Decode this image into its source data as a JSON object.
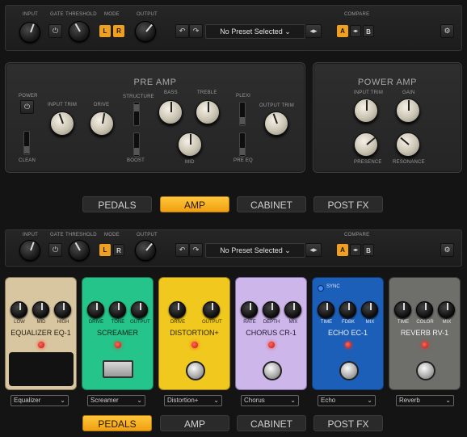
{
  "top_bar": {
    "labels": {
      "input": "INPUT",
      "gate": "GATE",
      "threshold": "THRESHOLD",
      "mode": "MODE",
      "output": "OUTPUT",
      "compare": "COMPARE"
    },
    "mode_l": "L",
    "mode_r": "R",
    "preset": "No Preset Selected",
    "compare_a": "A",
    "compare_arrows": "◂▸",
    "compare_b": "B"
  },
  "pre_amp": {
    "title": "PRE AMP",
    "power": "POWER",
    "input_trim": "INPUT TRIM",
    "drive": "DRIVE",
    "structure": "STRUCTURE",
    "bass": "BASS",
    "treble": "TREBLE",
    "plexi": "PLEXI",
    "output_trim": "OUTPUT TRIM",
    "clean": "CLEAN",
    "boost": "BOOST",
    "mid": "MID",
    "pre_eq": "PRE EQ"
  },
  "power_amp": {
    "title": "POWER AMP",
    "input_trim": "INPUT TRIM",
    "gain": "GAIN",
    "presence": "PRESENCE",
    "resonance": "RESONANCE"
  },
  "tabs_top": [
    {
      "label": "PEDALS",
      "active": false
    },
    {
      "label": "AMP",
      "active": true
    },
    {
      "label": "CABINET",
      "active": false
    },
    {
      "label": "POST FX",
      "active": false
    }
  ],
  "second_bar": {
    "labels": {
      "input": "INPUT",
      "gate": "GATE",
      "threshold": "THRESHOLD",
      "mode": "MODE",
      "output": "OUTPUT",
      "compare": "COMPARE"
    },
    "mode_l": "L",
    "mode_r": "R",
    "preset": "No Preset Selected",
    "compare_a": "A",
    "compare_arrows": "◂▸",
    "compare_b": "B"
  },
  "pedals": [
    {
      "name": "EQUALIZER EQ-1",
      "knobs": [
        "LOW",
        "MID",
        "HIGH"
      ],
      "dropdown": "Equalizer",
      "color": "#d8c6a0"
    },
    {
      "name": "SCREAMER",
      "knobs": [
        "DRIVE",
        "TONE",
        "OUTPUT"
      ],
      "dropdown": "Screamer",
      "color": "#24c48a"
    },
    {
      "name": "DISTORTION+",
      "knobs": [
        "DRIVE",
        "OUTPUT"
      ],
      "dropdown": "Distortion+",
      "color": "#f0c81e"
    },
    {
      "name": "CHORUS CR-1",
      "knobs": [
        "RATE",
        "DEPTH",
        "MIX"
      ],
      "dropdown": "Chorus",
      "color": "#cdb6ea"
    },
    {
      "name": "ECHO EC-1",
      "knobs": [
        "TIME",
        "FDBK",
        "MIX"
      ],
      "dropdown": "Echo",
      "color": "#1c5fb8",
      "sync": "SYNC"
    },
    {
      "name": "REVERB RV-1",
      "knobs": [
        "TIME",
        "COLOR",
        "MIX"
      ],
      "dropdown": "Reverb",
      "color": "#6e6e6a"
    }
  ],
  "tabs_bottom": [
    {
      "label": "PEDALS",
      "active": true
    },
    {
      "label": "AMP",
      "active": false
    },
    {
      "label": "CABINET",
      "active": false
    },
    {
      "label": "POST FX",
      "active": false
    }
  ]
}
